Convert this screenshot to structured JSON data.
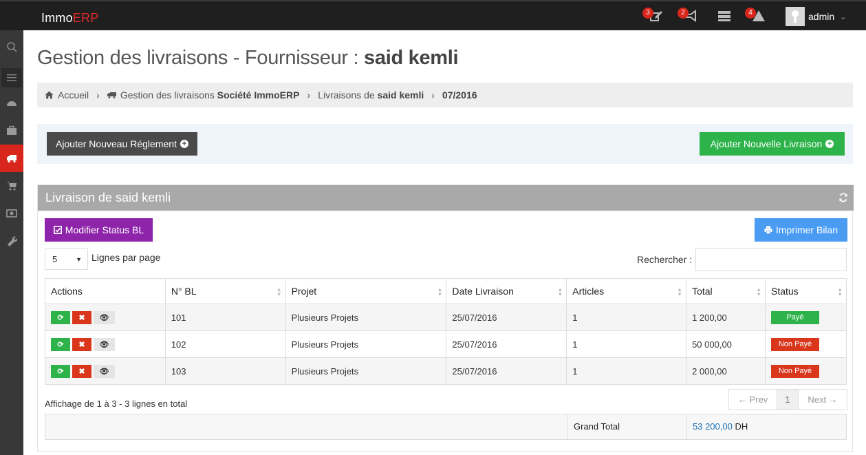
{
  "app": {
    "logo_main": "Immo",
    "logo_accent": "ERP"
  },
  "topbar": {
    "notifications": [
      {
        "icon": "edit-icon",
        "count": "3"
      },
      {
        "icon": "megaphone-icon",
        "count": "2"
      },
      {
        "icon": "server-icon",
        "count": ""
      },
      {
        "icon": "warning-icon",
        "count": "4"
      }
    ],
    "user": "admin"
  },
  "sidebar": {
    "items": [
      "search-icon",
      "menu-icon",
      "dashboard-icon",
      "briefcase-icon",
      "truck-icon",
      "cart-icon",
      "money-icon",
      "wrench-icon"
    ],
    "active": "truck-icon"
  },
  "page": {
    "title_prefix": "Gestion des livraisons - Fournisseur : ",
    "title_name": "said kemli"
  },
  "breadcrumb": {
    "home": "Accueil",
    "item2_prefix": "Gestion des livraisons ",
    "item2_bold": "Société ImmoERP",
    "item3_prefix": "Livraisons de ",
    "item3_bold": "said kemli",
    "item4": "07/2016"
  },
  "actions": {
    "add_payment": "Ajouter Nouveau Réglement",
    "add_delivery": "Ajouter Nouvelle Livraison"
  },
  "panel": {
    "title": "Livraison de said kemli",
    "modify_status": "Modifier Status BL",
    "print": "Imprimer Bilan",
    "per_page_value": "5",
    "per_page_label": "Lignes par page",
    "search_label": "Rechercher :",
    "search_value": ""
  },
  "table": {
    "headers": [
      "Actions",
      "N° BL",
      "Projet",
      "Date Livraison",
      "Articles",
      "Total",
      "Status"
    ],
    "rows": [
      {
        "bl": "101",
        "projet": "Plusieurs Projets",
        "date": "25/07/2016",
        "articles": "1",
        "total": "1 200,00",
        "status": "Payé",
        "paid": true
      },
      {
        "bl": "102",
        "projet": "Plusieurs Projets",
        "date": "25/07/2016",
        "articles": "1",
        "total": "50 000,00",
        "status": "Non Payé",
        "paid": false
      },
      {
        "bl": "103",
        "projet": "Plusieurs Projets",
        "date": "25/07/2016",
        "articles": "1",
        "total": "2 000,00",
        "status": "Non Payé",
        "paid": false
      }
    ]
  },
  "footer": {
    "info": "Affichage de 1 à 3 - 3 lignes en total",
    "prev": "← Prev",
    "page": "1",
    "next": "Next →",
    "grand_total_label": "Grand Total",
    "grand_total_value": "53 200,00",
    "currency": " DH"
  },
  "colors": {
    "accent_red": "#d9261c",
    "green": "#2db34a",
    "purple": "#8e24aa",
    "blue": "#4a9cf3"
  }
}
